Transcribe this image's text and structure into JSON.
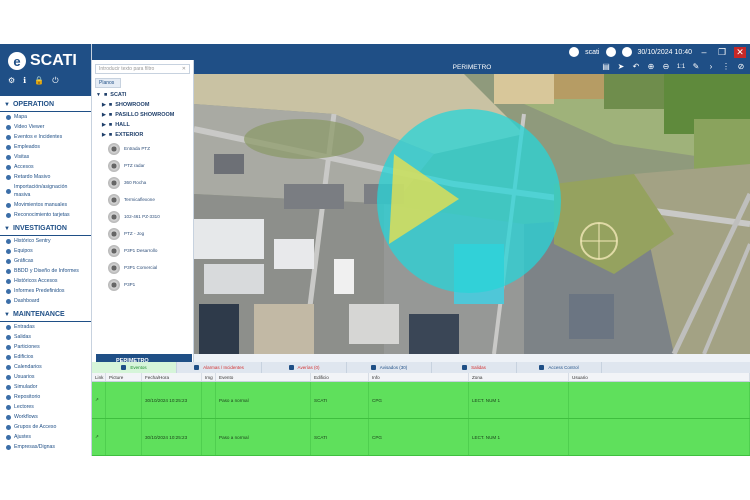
{
  "titlebar": {
    "user": "scati",
    "datetime": "30/10/2024 10:40",
    "minimize": "–",
    "restore": "❐",
    "close": "✕"
  },
  "brand": {
    "logo": "SCATI",
    "logo_mark": "e"
  },
  "sidebar": {
    "operation": {
      "title": "OPERATION",
      "items": [
        "Mapa",
        "Video Viewer",
        "Eventos e Incidentes",
        "Empleados",
        "Visitas",
        "Accesos",
        "Retardo Masivo",
        "Importación/asignación masiva",
        "Movimientos manuales",
        "Reconocimiento tarjetas"
      ]
    },
    "investigation": {
      "title": "INVESTIGATION",
      "items": [
        "Histórico Sentry",
        "Equipos",
        "Gráficas",
        "BBDD y Diseño de Informes",
        "Históricos Accesos",
        "Informes Predefinidos",
        "Dashboard"
      ]
    },
    "maintenance": {
      "title": "MAINTENANCE",
      "items": [
        "Entradas",
        "Salidas",
        "Particiones",
        "Edificios",
        "Calendarios",
        "Usuarios",
        "Simulador",
        "Repositorio",
        "Lectores",
        "Workflows",
        "Grupos de Acceso",
        "Ajustes",
        "Empresas/Dignas"
      ]
    }
  },
  "tree": {
    "search_placeholder": "Introducir texto para filtro",
    "tab": "Planos",
    "root": "SCATI",
    "nodes": [
      "SHOWROOM",
      "PASILLO SHOWROOM",
      "HALL",
      "EXTERIOR"
    ],
    "cameras": [
      "Entrada PTZ",
      "PTZ radar",
      "360 Rocha",
      "Termicaflexone",
      "102-461 PZ-3310",
      "PTZ - Jog",
      "P3P1 Desarrollo",
      "P3P1 Comercial",
      "P3P1"
    ],
    "selected": "PERIMETRO"
  },
  "map": {
    "title": "PERIMETRO",
    "zoom_label": "1:1"
  },
  "events": {
    "tabs": [
      {
        "label": "Eventos",
        "style": "active"
      },
      {
        "label": "Alarmas / Incidentes",
        "style": "alarm"
      },
      {
        "label": "Averías (0)",
        "style": "alarm"
      },
      {
        "label": "Avisados (30)",
        "style": "normal"
      },
      {
        "label": "Salidas",
        "style": "alarm"
      },
      {
        "label": "Access Control",
        "style": "normal"
      }
    ],
    "columns": [
      "Link",
      "Picture",
      "Fecha/Hora",
      "Img",
      "Evento",
      "Edificio",
      "Info",
      "Zona",
      "Usuario"
    ],
    "rows": [
      {
        "fecha": "30/10/2024 10:25:23",
        "evento": "Paso a normal",
        "edificio": "SCATI",
        "info": "CPG",
        "zona": "LECT. NUM 1",
        "usuario": ""
      },
      {
        "fecha": "30/10/2024 10:25:23",
        "evento": "Paso a normal",
        "edificio": "SCATI",
        "info": "CPG",
        "zona": "LECT. NUM 1",
        "usuario": ""
      }
    ]
  },
  "colors": {
    "brand": "#1f4f86",
    "event_row": "#5fe05c",
    "coverage_cyan": "#27d4d8",
    "fov_yellow": "#f0e04a"
  }
}
